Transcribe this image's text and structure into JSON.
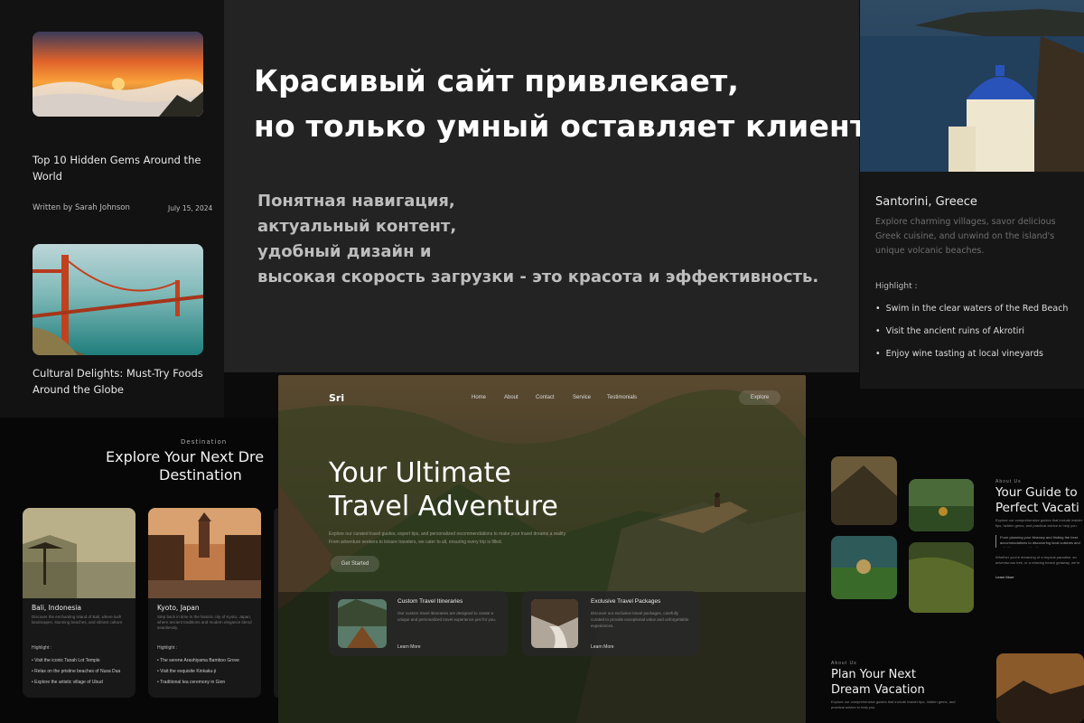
{
  "headline": {
    "line1": "Красивый сайт привлекает,",
    "line2": "но только умный оставляет клиентов."
  },
  "subtext": {
    "lines": [
      "Понятная навигация,",
      "актуальный контент,",
      "удобный дизайн и",
      "высокая скорость загрузки - это красота и эффективность."
    ]
  },
  "blog": {
    "post1": {
      "title": "Top 10 Hidden Gems Around the World",
      "author": "Written by Sarah Johnson",
      "date": "July 15, 2024"
    },
    "post2": {
      "title": "Cultural Delights: Must-Try Foods Around the Globe"
    }
  },
  "santorini": {
    "title": "Santorini, Greece",
    "description": "Explore charming villages, savor delicious Greek cuisine, and unwind on the island's unique volcanic beaches.",
    "highlight_label": "Highlight :",
    "highlights": [
      "Swim in the clear waters of the Red Beach",
      "Visit the ancient ruins of Akrotiri",
      "Enjoy wine tasting at local vineyards"
    ]
  },
  "destination": {
    "eyebrow": "Destination",
    "title_line1": "Explore Your Next Dre",
    "title_line2": "Destination",
    "cards": [
      {
        "title": "Bali, Indonesia",
        "description": "Discover the enchanting island of Bali, where lush landscapes, stunning beaches, and vibrant culture.",
        "highlight_label": "Highlight :",
        "items": [
          "Visit the iconic Tanah Lot Temple",
          "Relax on the pristine beaches of Nusa Dua",
          "Explore the artistic village of Ubud"
        ]
      },
      {
        "title": "Kyoto, Japan",
        "description": "Step back in time in the historic city of Kyoto, Japan, where ancient traditions and modern elegance blend seamlessly.",
        "highlight_label": "Highlight :",
        "items": [
          "The serene Arashiyama Bamboo Grove",
          "Visit the exquisite Kinkaku-ji",
          "Traditional tea ceremony in Gion"
        ]
      }
    ]
  },
  "hero": {
    "logo": "Sri",
    "nav": [
      "Home",
      "About",
      "Contact",
      "Service",
      "Testimonials"
    ],
    "explore_button": "Explore",
    "title_line1": "Your Ultimate",
    "title_line2": "Travel Adventure",
    "paragraph": "Explore our curated travel guides, expert tips, and personalized recommendations to make your travel dreams a reality. From adventure seekers to leisure travelers, we cater to all, ensuring every trip is filled.",
    "cta": "Get Started",
    "features": [
      {
        "title": "Custom Travel Itineraries",
        "text": "Our custom travel itineraries are designed to create a unique and personalized travel experience just for you.",
        "link": "Learn More"
      },
      {
        "title": "Exclusive Travel Packages",
        "text": "Discover our exclusive travel packages, carefully curated to provide exceptional value and unforgettable experiences.",
        "link": "Learn More"
      }
    ]
  },
  "guide": {
    "eyebrow": "About Us",
    "title_line1": "Your Guide to",
    "title_line2": "Perfect Vacati",
    "intro": "Explore our comprehensive guides that include insider tips, hidden gems, and practical advice to help you.",
    "quote": "From planning your itinerary and finding the best accommodations to discovering local cuisines and activities, we provide all.",
    "text": "Whether you're dreaming of a tropical paradise, an adventurous trek, or a relaxing beach getaway, we're your guide.",
    "link": "Learn More"
  },
  "plan": {
    "eyebrow": "About Us",
    "title_line1": "Plan Your Next",
    "title_line2": "Dream Vacation",
    "text": "Explore our comprehensive guides that include insider tips, hidden gems, and practical advice to help you."
  }
}
